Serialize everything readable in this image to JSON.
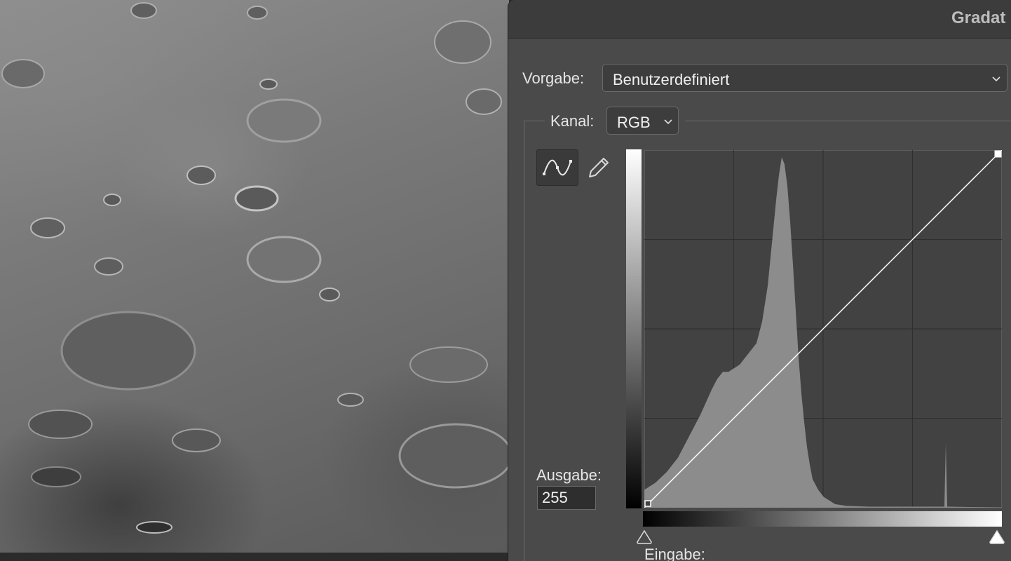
{
  "dialog": {
    "title": "Gradat",
    "preset_label": "Vorgabe:",
    "preset_value": "Benutzerdefiniert",
    "channel_label": "Kanal:",
    "channel_value": "RGB",
    "output_label": "Ausgabe:",
    "output_value": "255",
    "input_label": "Eingabe:"
  },
  "icons": {
    "curve_tool": "curve-point-icon",
    "pencil_tool": "pencil-icon",
    "preset_chevron": "chevron-down-icon",
    "channel_chevron": "chevron-down-icon"
  },
  "colors": {
    "dialog_bg": "#4a4a4a",
    "graph_bg": "#424242",
    "histogram": "#8c8c8c",
    "curve": "#ffffff"
  },
  "chart_data": {
    "type": "area",
    "x_range": [
      0,
      255
    ],
    "y_range": [
      0,
      255
    ],
    "grid_divisions": 4,
    "histogram_x": [
      0,
      8,
      16,
      24,
      32,
      40,
      48,
      52,
      56,
      60,
      64,
      68,
      72,
      76,
      80,
      84,
      88,
      90,
      92,
      94,
      96,
      98,
      100,
      102,
      104,
      106,
      108,
      110,
      112,
      114,
      116,
      118,
      120,
      124,
      128,
      132,
      136,
      144,
      160,
      176,
      192,
      208,
      214,
      215,
      216,
      232,
      255
    ],
    "histogram_y": [
      0.05,
      0.07,
      0.1,
      0.14,
      0.2,
      0.26,
      0.33,
      0.36,
      0.38,
      0.38,
      0.39,
      0.4,
      0.42,
      0.44,
      0.46,
      0.52,
      0.62,
      0.7,
      0.78,
      0.86,
      0.93,
      0.98,
      0.96,
      0.9,
      0.8,
      0.68,
      0.55,
      0.42,
      0.32,
      0.24,
      0.17,
      0.12,
      0.08,
      0.05,
      0.03,
      0.02,
      0.01,
      0.005,
      0.003,
      0.003,
      0.003,
      0.003,
      0.003,
      0.18,
      0.003,
      0.002,
      0.001
    ],
    "curve_points": [
      [
        0,
        0
      ],
      [
        255,
        255
      ]
    ]
  }
}
